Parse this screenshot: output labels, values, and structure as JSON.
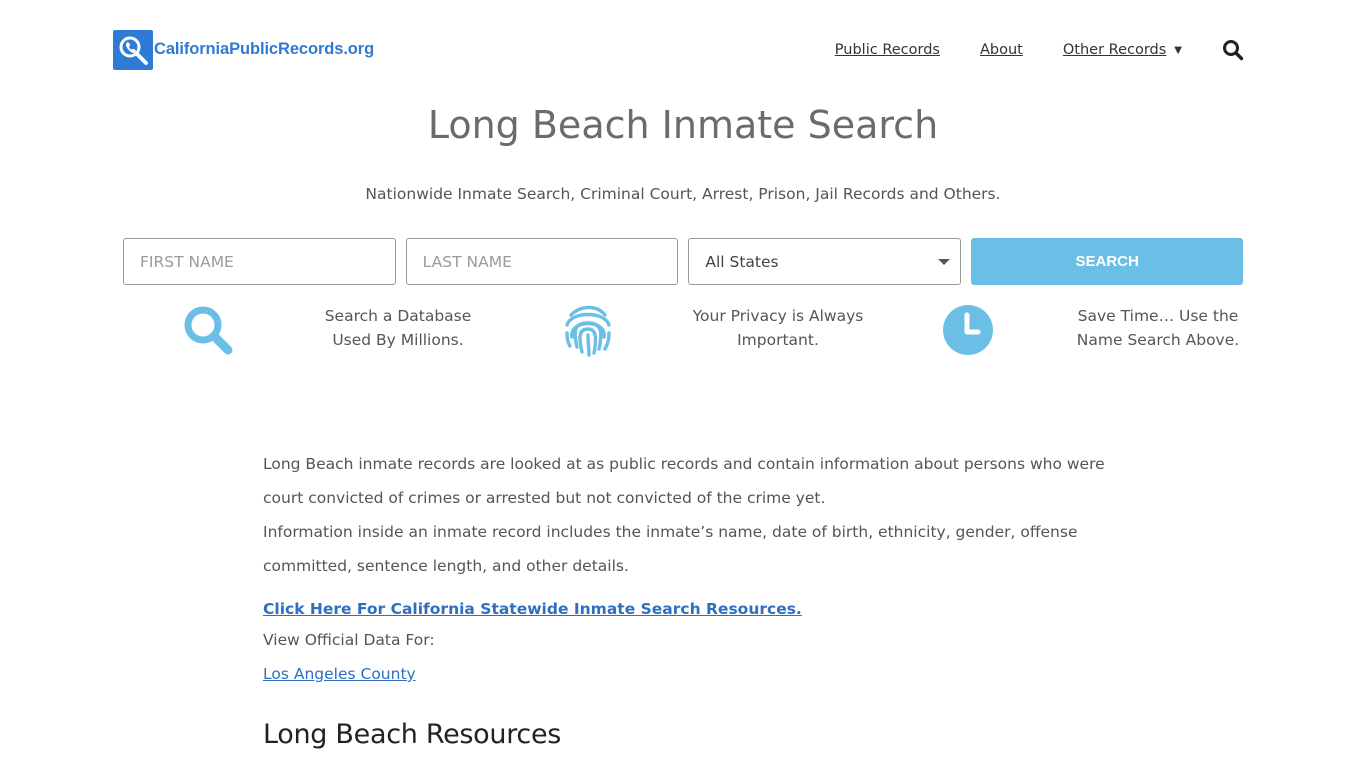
{
  "header": {
    "logo_text": "CaliforniaPublicRecords.org",
    "nav": {
      "public_records": "Public Records",
      "about": "About",
      "other_records": "Other Records"
    }
  },
  "main": {
    "title": "Long Beach Inmate Search",
    "subtitle": "Nationwide Inmate Search, Criminal Court, Arrest, Prison, Jail Records and Others."
  },
  "search": {
    "first_name_placeholder": "FIRST NAME",
    "last_name_placeholder": "LAST NAME",
    "state_selected": "All States",
    "button_label": "SEARCH"
  },
  "features": [
    {
      "icon": "search-icon",
      "line1": "Search a Database",
      "line2": "Used By Millions."
    },
    {
      "icon": "fingerprint-icon",
      "line1": "Your Privacy is Always",
      "line2": "Important."
    },
    {
      "icon": "clock-icon",
      "line1": "Save Time… Use the",
      "line2": "Name Search Above."
    }
  ],
  "content": {
    "paragraph1": "Long Beach inmate records are looked at as public records and contain information about persons who were court convicted of crimes or arrested but not convicted of the crime yet.",
    "paragraph2": "Information inside an inmate record includes the inmate’s name, date of birth, ethnicity, gender, offense committed, sentence length, and other details.",
    "statewide_link": "Click Here For California Statewide Inmate Search Resources.",
    "view_label": "View Official Data For:",
    "county_link": "Los Angeles County",
    "resources_heading": "Long Beach Resources"
  },
  "colors": {
    "brand_blue": "#2e7bd6",
    "accent_light_blue": "#6bbfe6",
    "link_blue": "#2e6fc0"
  }
}
